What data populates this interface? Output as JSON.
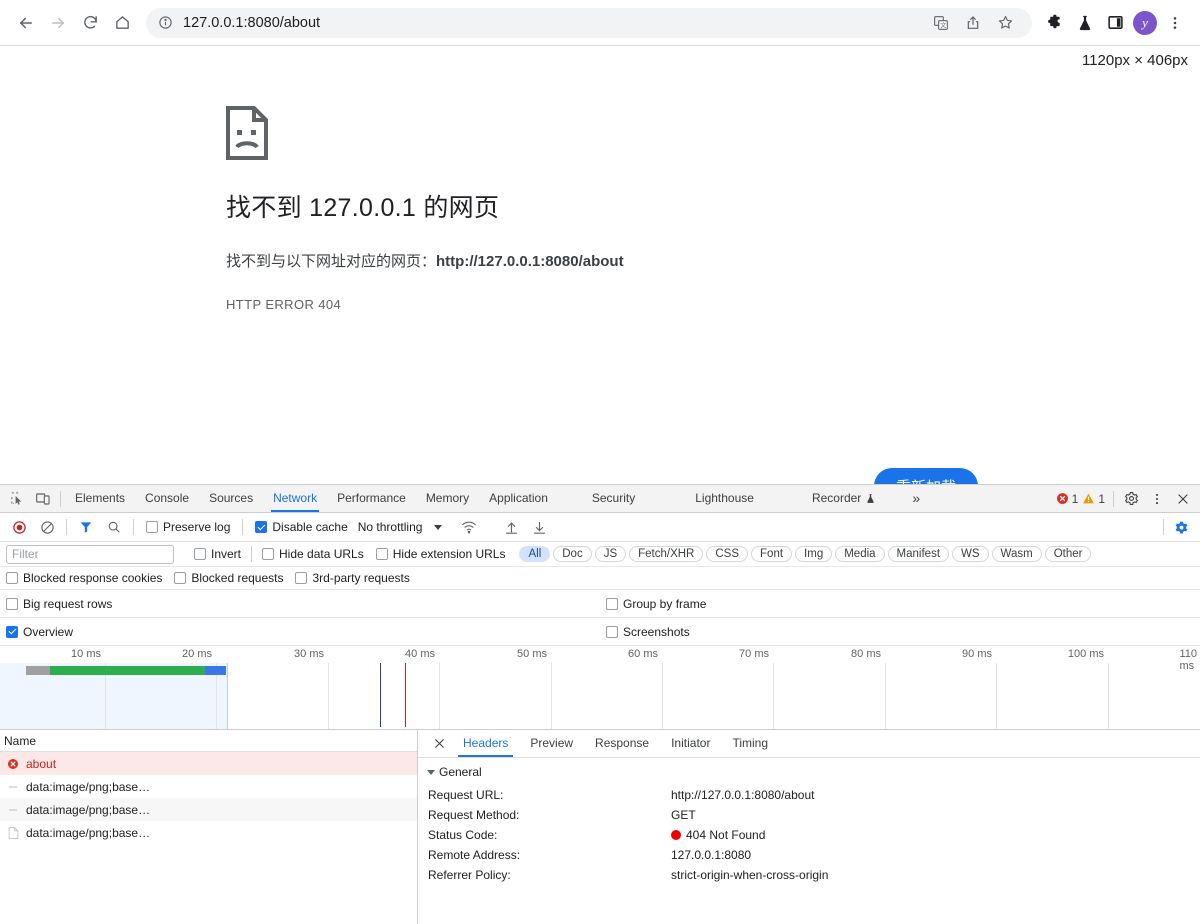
{
  "browser": {
    "back_label": "Back",
    "forward_label": "Forward",
    "reload_label": "Reload",
    "home_label": "Home",
    "url": "127.0.0.1:8080/about",
    "toolbar_icons": [
      "translate-icon",
      "share-icon",
      "bookmark-star-icon",
      "extensions-icon",
      "flask-icon",
      "side-panel-icon"
    ],
    "avatar_letter": "y",
    "menu_label": "Customize and control"
  },
  "page": {
    "size_badge": "1120px × 406px",
    "title": "找不到 127.0.0.1 的网页",
    "description_prefix": "找不到与以下网址对应的网页：",
    "description_url": "http://127.0.0.1:8080/about",
    "error_code": "HTTP ERROR 404",
    "reload_button": "重新加载"
  },
  "devtools": {
    "tabs": [
      {
        "label": "Elements",
        "active": false
      },
      {
        "label": "Console",
        "active": false
      },
      {
        "label": "Sources",
        "active": false
      },
      {
        "label": "Network",
        "active": true
      },
      {
        "label": "Performance",
        "active": false
      },
      {
        "label": "Memory",
        "active": false
      },
      {
        "label": "Application",
        "active": false
      },
      {
        "label": "Security",
        "active": false
      },
      {
        "label": "Lighthouse",
        "active": false
      },
      {
        "label": "Recorder",
        "active": false
      }
    ],
    "more_tabs": "»",
    "error_count": "1",
    "warning_count": "1",
    "inspect_icon": "inspect-element-icon",
    "device_icon": "device-toolbar-icon",
    "settings_icon": "gear-icon",
    "more_icon": "kebab-menu-icon",
    "close_icon": "close-icon"
  },
  "network_toolbar": {
    "record_label": "Stop recording network log",
    "clear_label": "Clear",
    "filter_label": "Filter",
    "search_label": "Search",
    "preserve_log": {
      "label": "Preserve log",
      "checked": false
    },
    "disable_cache": {
      "label": "Disable cache",
      "checked": true
    },
    "throttling": "No throttling",
    "wifi_icon": "network-conditions-icon",
    "import_icon": "import-har-icon",
    "export_icon": "export-har-icon",
    "settings_icon": "network-settings-gear-icon"
  },
  "filter_bar": {
    "placeholder": "Filter",
    "value": "",
    "invert": {
      "label": "Invert",
      "checked": false
    },
    "hide_data_urls": {
      "label": "Hide data URLs",
      "checked": false
    },
    "hide_extension_urls": {
      "label": "Hide extension URLs",
      "checked": false
    },
    "type_chips": [
      {
        "label": "All",
        "selected": true
      },
      {
        "label": "Doc",
        "selected": false
      },
      {
        "label": "JS",
        "selected": false
      },
      {
        "label": "Fetch/XHR",
        "selected": false
      },
      {
        "label": "CSS",
        "selected": false
      },
      {
        "label": "Font",
        "selected": false
      },
      {
        "label": "Img",
        "selected": false
      },
      {
        "label": "Media",
        "selected": false
      },
      {
        "label": "Manifest",
        "selected": false
      },
      {
        "label": "WS",
        "selected": false
      },
      {
        "label": "Wasm",
        "selected": false
      },
      {
        "label": "Other",
        "selected": false
      }
    ]
  },
  "options": {
    "blocked_response_cookies": {
      "label": "Blocked response cookies",
      "checked": false
    },
    "blocked_requests": {
      "label": "Blocked requests",
      "checked": false
    },
    "third_party_requests": {
      "label": "3rd-party requests",
      "checked": false
    },
    "big_request_rows": {
      "label": "Big request rows",
      "checked": false
    },
    "group_by_frame": {
      "label": "Group by frame",
      "checked": false
    },
    "overview": {
      "label": "Overview",
      "checked": true
    },
    "screenshots": {
      "label": "Screenshots",
      "checked": false
    }
  },
  "overview": {
    "ticks": [
      "10 ms",
      "20 ms",
      "30 ms",
      "40 ms",
      "50 ms",
      "60 ms",
      "70 ms",
      "80 ms",
      "90 ms",
      "100 ms",
      "110 ms"
    ]
  },
  "request_list": {
    "column_header": "Name",
    "rows": [
      {
        "name": "about",
        "status": "error",
        "icon": "error-circle-icon"
      },
      {
        "name": "data:image/png;base…",
        "status": "ok",
        "icon": "dash-icon"
      },
      {
        "name": "data:image/png;base…",
        "status": "ok",
        "icon": "dash-icon"
      },
      {
        "name": "data:image/png;base…",
        "status": "ok",
        "icon": "document-icon"
      }
    ]
  },
  "detail": {
    "tabs": [
      {
        "label": "Headers",
        "active": true
      },
      {
        "label": "Preview",
        "active": false
      },
      {
        "label": "Response",
        "active": false
      },
      {
        "label": "Initiator",
        "active": false
      },
      {
        "label": "Timing",
        "active": false
      }
    ],
    "section_title": "General",
    "general": [
      {
        "key": "Request URL:",
        "value": "http://127.0.0.1:8080/about",
        "dot": false
      },
      {
        "key": "Request Method:",
        "value": "GET",
        "dot": false
      },
      {
        "key": "Status Code:",
        "value": "404 Not Found",
        "dot": true
      },
      {
        "key": "Remote Address:",
        "value": "127.0.0.1:8080",
        "dot": false
      },
      {
        "key": "Referrer Policy:",
        "value": "strict-origin-when-cross-origin",
        "dot": false
      }
    ]
  },
  "colors": {
    "accent": "#1a73e8",
    "error": "#c5221f",
    "error_row_bg": "#fce8e6",
    "status_dot": "#ee0000",
    "avatar": "#7b55c9",
    "bar_gray": "#a0a0a0",
    "bar_green": "#2eaf4e",
    "bar_blue": "#3b78e7"
  }
}
